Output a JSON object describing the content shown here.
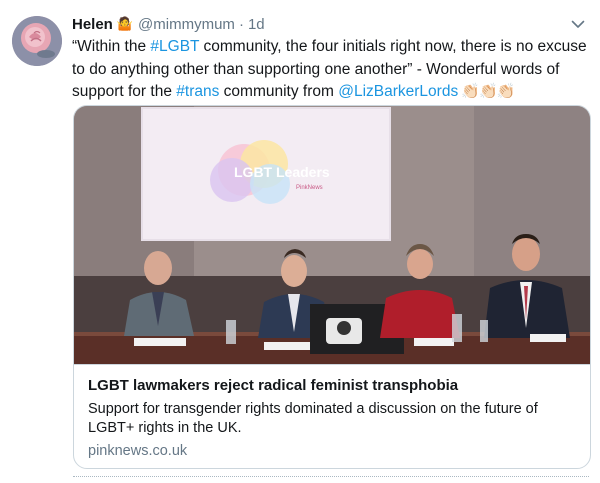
{
  "tweet": {
    "author_name": "Helen",
    "author_emoji": "🤷",
    "handle": "@mimmymum",
    "separator": "·",
    "time": "1d",
    "text_parts": {
      "quote_open": "“Within the ",
      "hashtag_lgbt": "#LGBT",
      "quote_rest": " community, the four initials right now, there is no excuse to do anything other than supporting one another” - Wonderful words of support for the ",
      "hashtag_trans": "#trans",
      "mid": " community from ",
      "mention": "@LizBarkerLords",
      "claps": " 👏🏻👏🏻👏🏻"
    },
    "menu_icon": "chevron-down-icon"
  },
  "card": {
    "title": "LGBT lawmakers reject radical feminist transphobia",
    "description": "Support for transgender rights dominated a discussion on the future of LGBT+ rights in the UK.",
    "domain": "pinknews.co.uk",
    "photo": {
      "screen_logo_text": "LGBT Leaders",
      "screen_logo_sub": "PinkNews"
    }
  },
  "colors": {
    "link": "#1b95e0",
    "secondary_text": "#657786",
    "border": "#ccd6dd"
  }
}
